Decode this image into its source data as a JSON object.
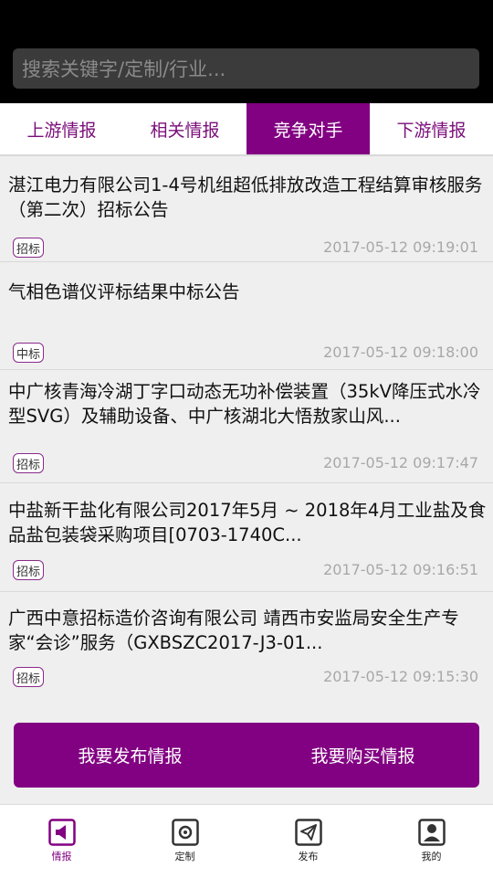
{
  "search": {
    "placeholder": "搜索关键字/定制/行业..."
  },
  "tabs": [
    {
      "label": "上游情报",
      "active": false
    },
    {
      "label": "相关情报",
      "active": false
    },
    {
      "label": "竞争对手",
      "active": true
    },
    {
      "label": "下游情报",
      "active": false
    }
  ],
  "items": [
    {
      "title": "湛江电力有限公司1-4号机组超低排放改造工程结算审核服务（第二次）招标公告",
      "tag": "招标",
      "time": "2017-05-12 09:19:01"
    },
    {
      "title": "气相色谱仪评标结果中标公告",
      "tag": "中标",
      "time": "2017-05-12 09:18:00"
    },
    {
      "title": "中广核青海冷湖丁字口动态无功补偿装置（35kV降压式水冷型SVG）及辅助设备、中广核湖北大悟敖家山风...",
      "tag": "招标",
      "time": "2017-05-12 09:17:47"
    },
    {
      "title": "中盐新干盐化有限公司2017年5月 ~ 2018年4月工业盐及食品盐包装袋采购项目[0703-1740C...",
      "tag": "招标",
      "time": "2017-05-12 09:16:51"
    },
    {
      "title": "广西中意招标造价咨询有限公司 靖西市安监局安全生产专家“会诊”服务（GXBSZC2017-J3-01...",
      "tag": "招标",
      "time": "2017-05-12 09:15:30"
    }
  ],
  "actions": {
    "publish": "我要发布情报",
    "buy": "我要购买情报"
  },
  "nav": [
    {
      "label": "情报",
      "icon": "megaphone-icon",
      "active": true
    },
    {
      "label": "定制",
      "icon": "target-icon",
      "active": false
    },
    {
      "label": "发布",
      "icon": "send-icon",
      "active": false
    },
    {
      "label": "我的",
      "icon": "user-icon",
      "active": false
    }
  ],
  "colors": {
    "brand": "#820082",
    "time": "#a8a8a8",
    "background": "#efefef"
  }
}
